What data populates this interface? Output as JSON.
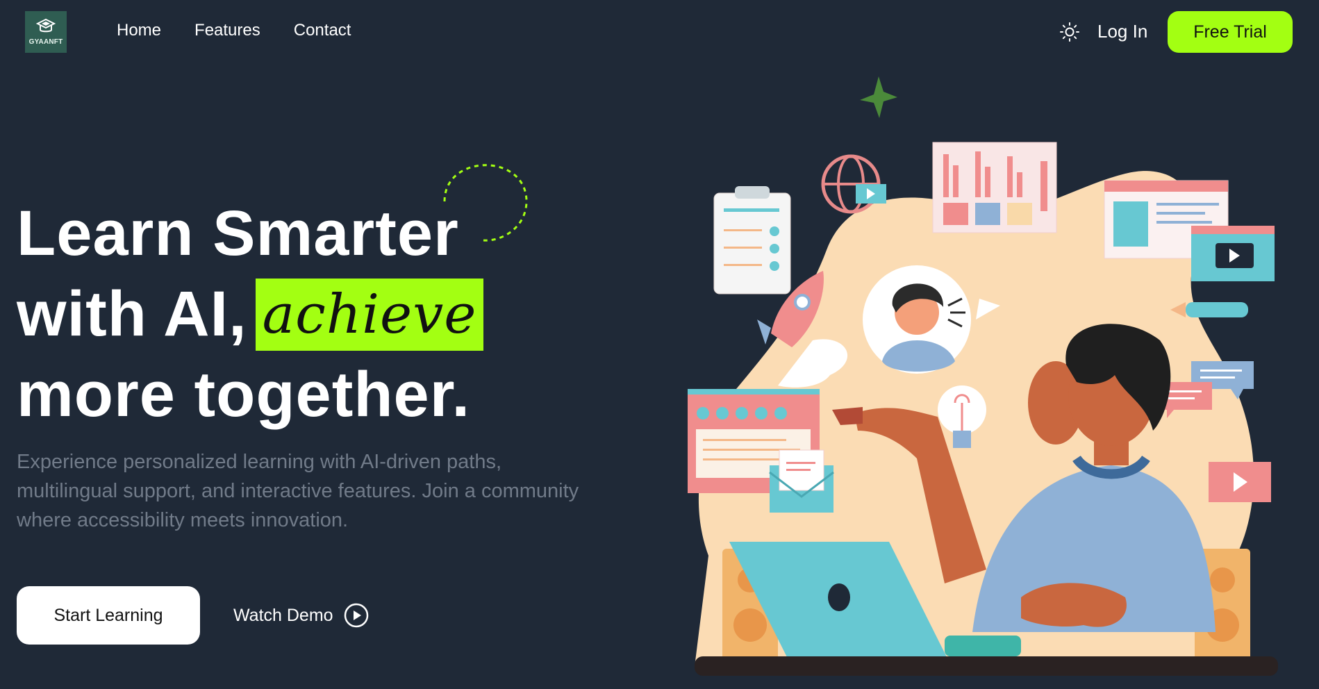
{
  "brand": {
    "logo_text": "GYAANFT",
    "accent": "#a3ff12",
    "background": "#1f2937"
  },
  "nav": {
    "links": [
      "Home",
      "Features",
      "Contact"
    ],
    "theme_icon": "sun-icon",
    "login_label": "Log In",
    "trial_label": "Free Trial"
  },
  "hero": {
    "line1": "Learn Smarter",
    "line2": "with AI,",
    "highlight": "achieve",
    "line3": "more together.",
    "subtext": "Experience personalized learning with AI-driven paths, multilingual support, and interactive features. Join a community where accessibility meets innovation.",
    "start_label": "Start Learning",
    "demo_label": "Watch Demo",
    "demo_icon": "play-circle-icon"
  },
  "illustration": {
    "subject": "person-at-laptop-illustration"
  }
}
